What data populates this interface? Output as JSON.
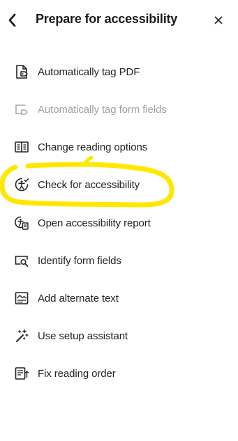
{
  "header": {
    "title": "Prepare for accessibility",
    "back_icon": "chevron-left-icon",
    "close_icon": "close-icon",
    "close_glyph": "×"
  },
  "items": [
    {
      "label": "Automatically tag PDF",
      "icon": "tag-document-icon",
      "enabled": true
    },
    {
      "label": "Automatically tag form fields",
      "icon": "tag-form-fields-icon",
      "enabled": false
    },
    {
      "label": "Change reading options",
      "icon": "book-icon",
      "enabled": true
    },
    {
      "label": "Check for accessibility",
      "icon": "accessibility-check-icon",
      "enabled": true
    },
    {
      "label": "Open accessibility report",
      "icon": "accessibility-report-icon",
      "enabled": true
    },
    {
      "label": "Identify form fields",
      "icon": "identify-form-fields-icon",
      "enabled": true
    },
    {
      "label": "Add alternate text",
      "icon": "alternate-text-icon",
      "enabled": true
    },
    {
      "label": "Use setup assistant",
      "icon": "magic-wand-icon",
      "enabled": true
    },
    {
      "label": "Fix reading order",
      "icon": "reading-order-icon",
      "enabled": true
    }
  ],
  "annotation": {
    "highlight_color": "#ffe800",
    "highlighted_item": "Check for accessibility"
  }
}
